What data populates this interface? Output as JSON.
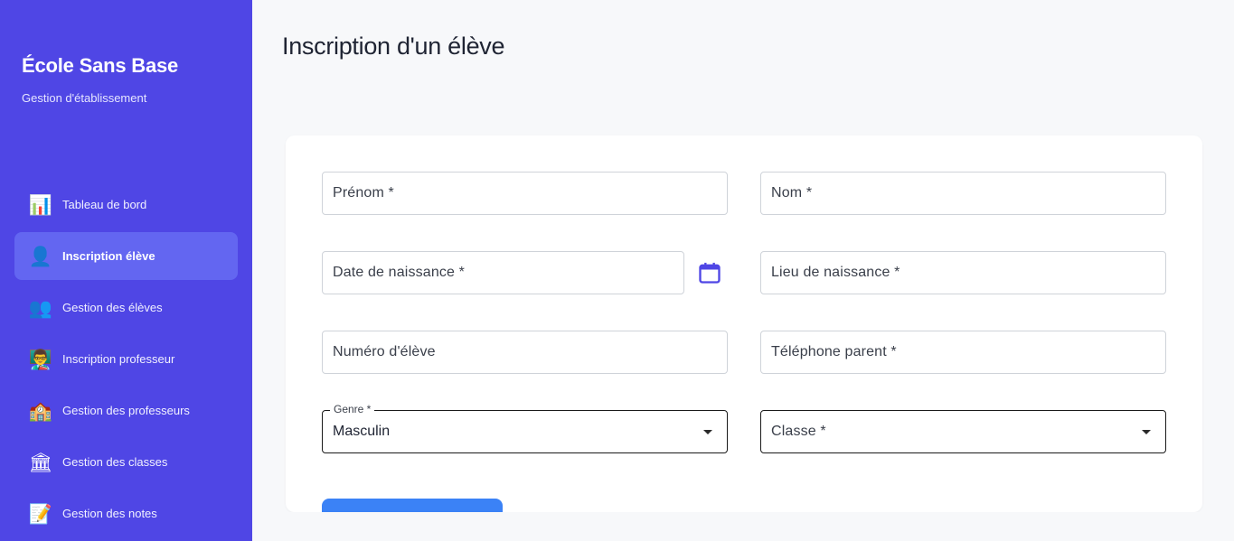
{
  "sidebar": {
    "brand": "École Sans Base",
    "subtitle": "Gestion d'établissement",
    "items": [
      {
        "icon": "📊",
        "label": "Tableau de bord"
      },
      {
        "icon": "👤",
        "label": "Inscription élève"
      },
      {
        "icon": "👥",
        "label": "Gestion des élèves"
      },
      {
        "icon": "👨‍🏫",
        "label": "Inscription professeur"
      },
      {
        "icon": "🏫",
        "label": "Gestion des professeurs"
      },
      {
        "icon": "🏛",
        "label": "Gestion des classes"
      },
      {
        "icon": "📝",
        "label": "Gestion des notes"
      }
    ],
    "active_index": 1
  },
  "page": {
    "title": "Inscription d'un élève"
  },
  "form": {
    "prenom": {
      "placeholder": "Prénom *"
    },
    "nom": {
      "placeholder": "Nom *"
    },
    "date_naissance": {
      "placeholder": "Date de naissance *"
    },
    "lieu_naissance": {
      "placeholder": "Lieu de naissance *"
    },
    "numero_eleve": {
      "placeholder": "Numéro d'élève"
    },
    "telephone_parent": {
      "placeholder": "Téléphone parent *"
    },
    "genre": {
      "label": "Genre *",
      "value": "Masculin"
    },
    "classe": {
      "placeholder": "Classe *"
    }
  },
  "colors": {
    "sidebar": "#4f46e5",
    "sidebar_active": "#6366f1",
    "primary": "#3b82f6",
    "calendar_icon": "#4f46e5"
  }
}
